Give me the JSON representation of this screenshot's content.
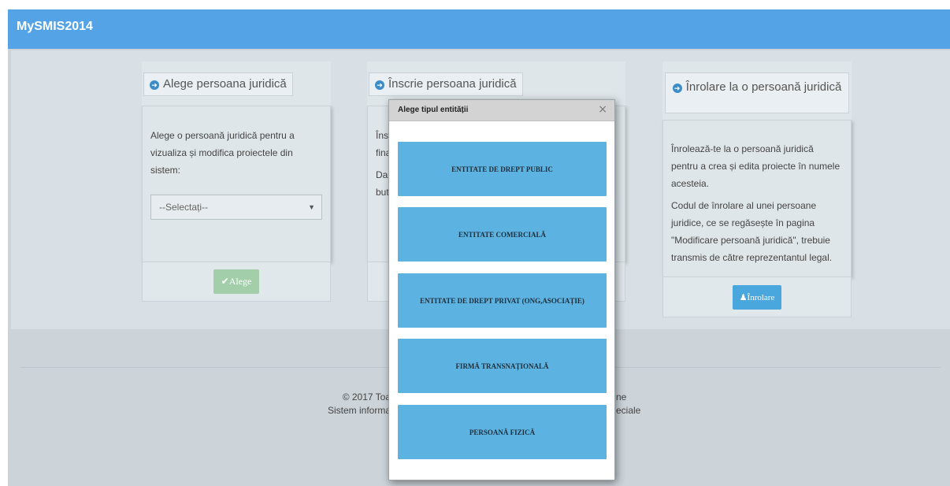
{
  "header": {
    "brand": "MySMIS2014"
  },
  "col1": {
    "title": "Alege persoana juridică",
    "description": "Alege o persoană juridică pentru a vizualiza și modifica proiectele din sistem:",
    "select_value": "--Selectați--",
    "button_label": "Alege"
  },
  "col2": {
    "title": "Înscrie persoana juridică",
    "line1": "Însc",
    "line2": "fina",
    "line3": "Dac",
    "line4": "but"
  },
  "col3": {
    "title": "Înrolare la o persoană juridică",
    "para1": "Înrolează-te la o persoană juridică pentru a crea și edita proiecte în numele acesteia.",
    "para2": "Codul de înrolare al unei persoane juridice, ce se regăsește în pagina \"Modificare persoană juridică\", trebuie transmis de către reprezentantul legal.",
    "button_label": "Înrolare"
  },
  "footer": {
    "left_line1": "© 2017 Toa",
    "left_line2": "Sistem informa",
    "right_line1": "ne",
    "right_line2": "eciale"
  },
  "modal": {
    "title": "Alege tipul entității",
    "close_glyph": "×",
    "options": [
      "ENTITATE DE DREPT PUBLIC",
      "ENTITATE COMERCIALĂ",
      "ENTITATE DE DREPT PRIVAT (ONG,ASOCIAȚIE)",
      "FIRMĂ TRANSNAȚIONALĂ",
      "PERSOANĂ FIZICĂ"
    ]
  },
  "colors": {
    "header": "#54a3e6",
    "option_button": "#5cb3e1",
    "green_button": "#a3ceaa",
    "blue_button": "#4aa7de"
  },
  "icons": {
    "column_heading": "arrow-right-circle-icon",
    "alege_button": "checkmark-icon",
    "inrolare_button": "user-icon",
    "select": "caret-down-icon",
    "modal_close": "close-icon"
  }
}
